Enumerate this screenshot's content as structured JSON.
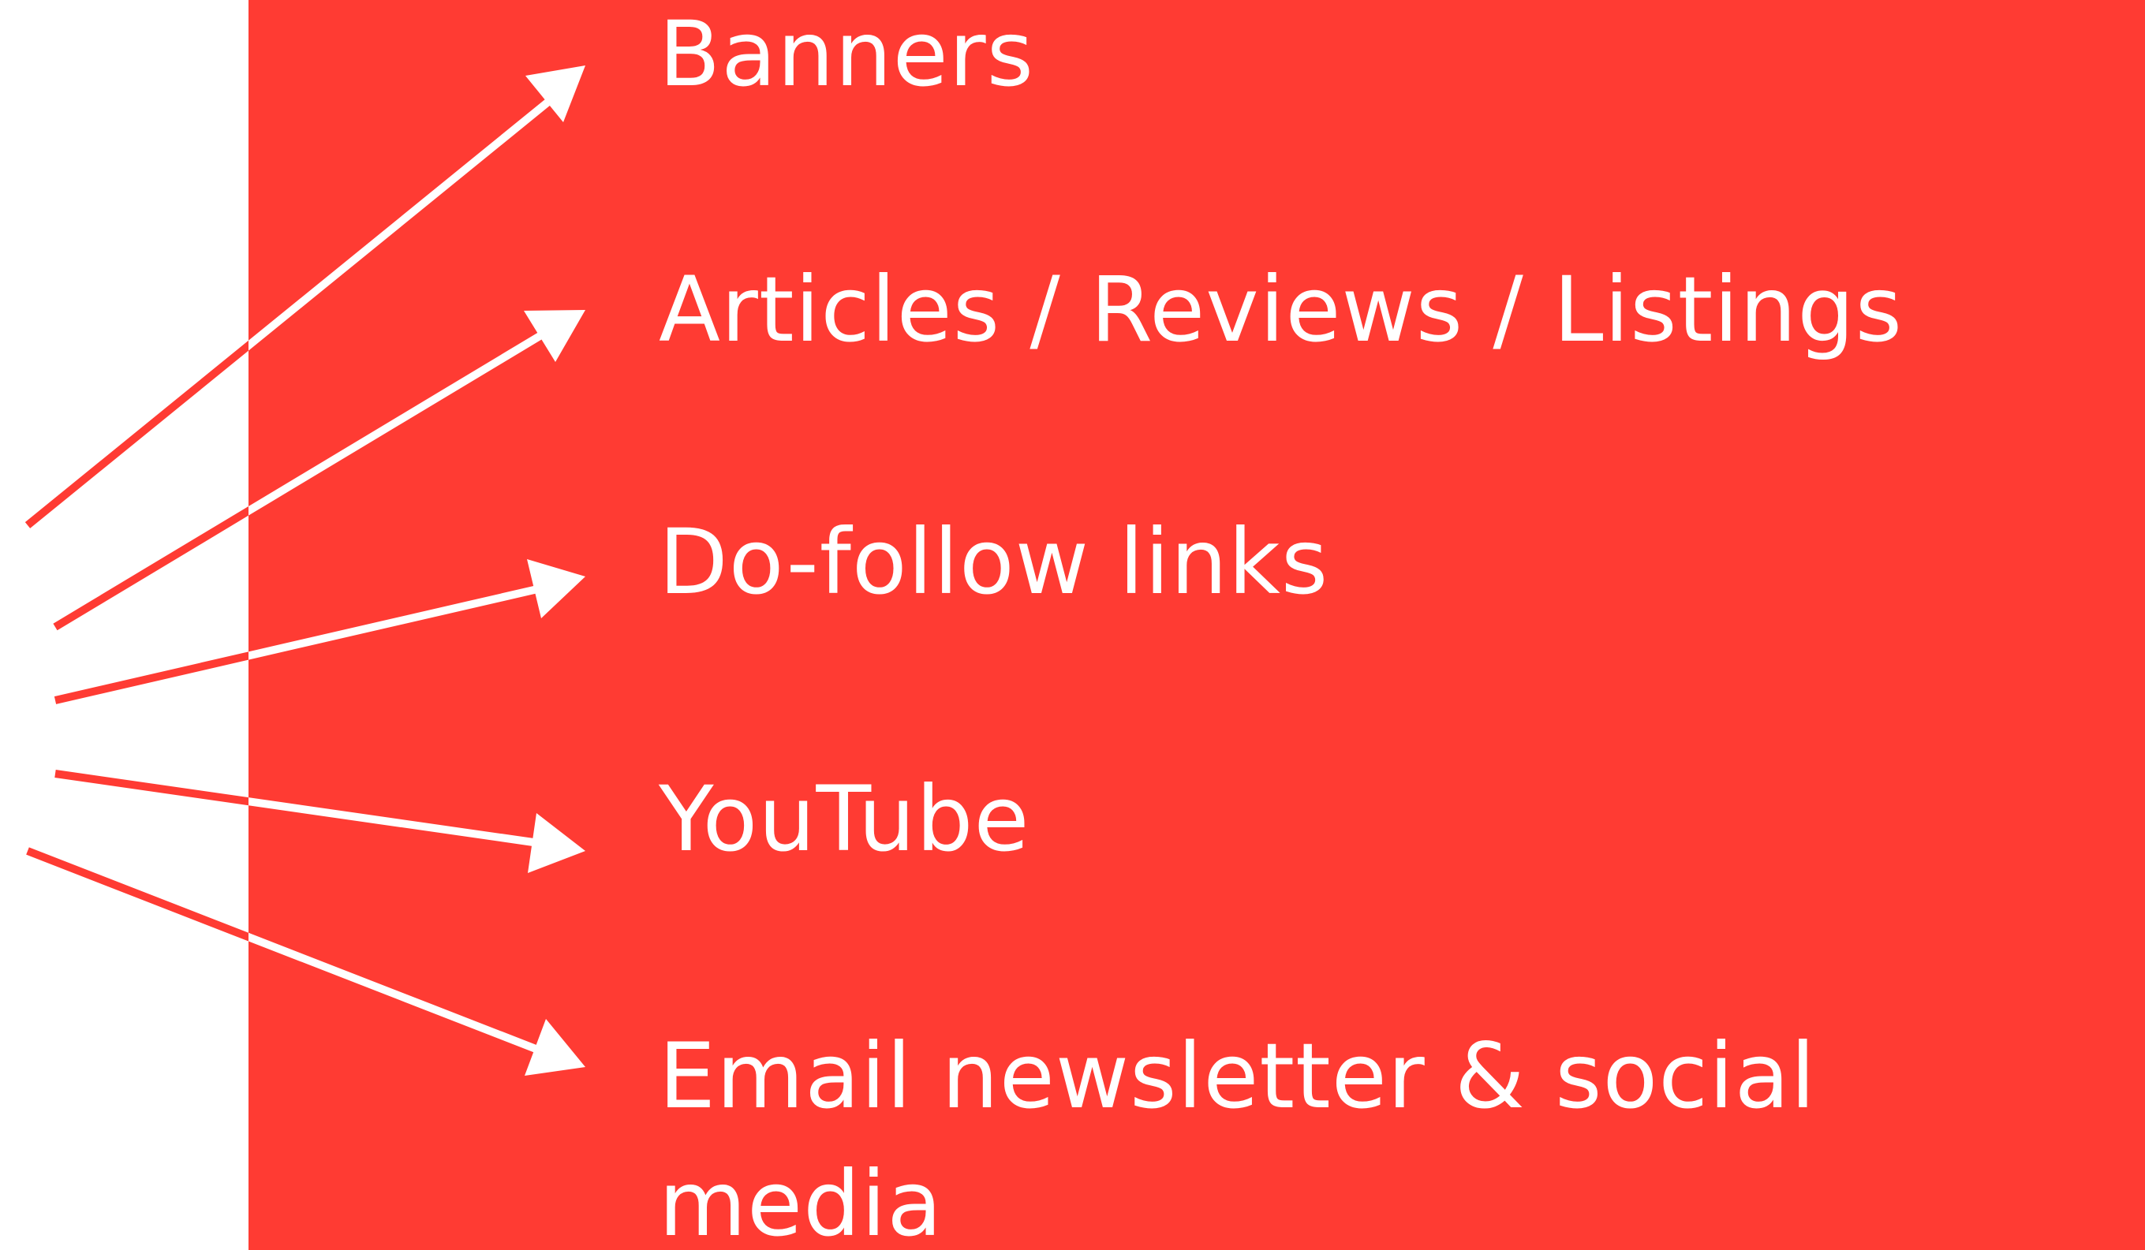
{
  "items": [
    {
      "label": "Banners"
    },
    {
      "label": "Articles / Reviews / Listings"
    },
    {
      "label": "Do-follow links"
    },
    {
      "label": "YouTube"
    },
    {
      "label": "Email newsletter & social media"
    }
  ],
  "colors": {
    "background": "#ffffff",
    "panel": "#ff3b33",
    "text": "#ffffff"
  },
  "icons": [
    "arrow-icon"
  ]
}
